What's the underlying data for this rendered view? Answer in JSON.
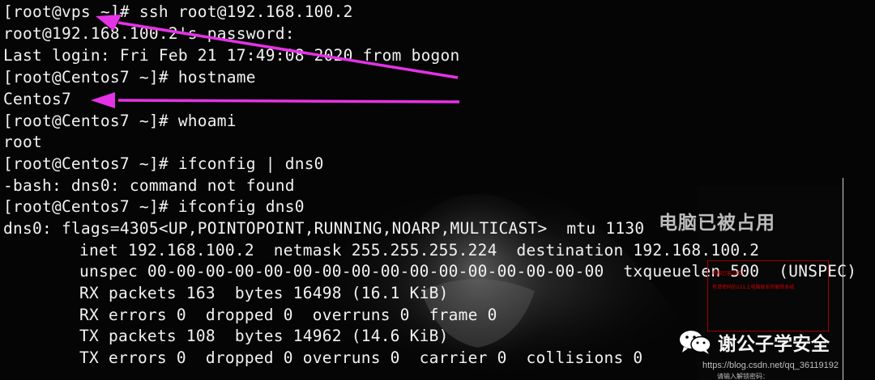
{
  "terminal": {
    "lines": [
      "[root@vps ~]# ssh root@192.168.100.2",
      "root@192.168.100.2's password:",
      "Last login: Fri Feb 21 17:49:08 2020 from bogon",
      "[root@Centos7 ~]# hostname",
      "Centos7",
      "[root@Centos7 ~]# whoami",
      "root",
      "[root@Centos7 ~]# ifconfig | dns0",
      "-bash: dns0: command not found",
      "[root@Centos7 ~]# ifconfig dns0",
      "dns0: flags=4305<UP,POINTOPOINT,RUNNING,NOARP,MULTICAST>  mtu 1130",
      "inet 192.168.100.2  netmask 255.255.255.224  destination 192.168.100.2",
      "unspec 00-00-00-00-00-00-00-00-00-00-00-00-00-00-00-00  txqueuelen 500  (UNSPEC)",
      "RX packets 163  bytes 16498 (16.1 KiB)",
      "RX errors 0  dropped 0  overruns 0  frame 0",
      "TX packets 108  bytes 14962 (14.6 KiB)",
      "TX errors 0  dropped 0 overruns 0  carrier 0  collisions 0"
    ]
  },
  "overlay": {
    "title": "电脑已被占用",
    "ransom_line1": "电脑已被占用！",
    "ransom_line2": "有请密码的211上电脑联系的解除系统",
    "hint": "请输入解锁密码："
  },
  "watermark": {
    "wechat_label": "谢公子学安全",
    "url": "https://blog.csdn.net/qq_36119192"
  },
  "colors": {
    "terminal_bg": "#050505",
    "text": "#f2f2f2",
    "arrow": "#e632e6"
  },
  "icons": {
    "wechat": "wechat-icon",
    "arrow": "arrow-annotation"
  }
}
